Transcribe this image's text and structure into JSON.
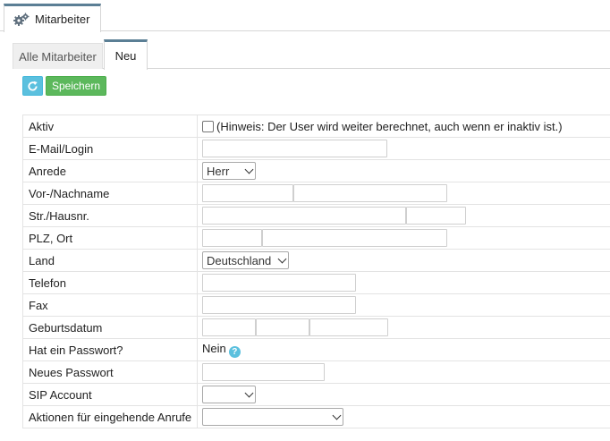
{
  "top_tab": {
    "label": "Mitarbeiter",
    "icon": "gears-icon"
  },
  "sub_tabs": [
    {
      "label": "Alle Mitarbeiter",
      "active": false
    },
    {
      "label": "Neu",
      "active": true
    }
  ],
  "toolbar": {
    "refresh_icon": "refresh-icon",
    "save_label": "Speichern"
  },
  "colors": {
    "accent_tab": "#5b7f95",
    "refresh_btn": "#5bc0de",
    "save_btn": "#5cb85c"
  },
  "form": {
    "aktiv": {
      "label": "Aktiv",
      "checked": false,
      "hint": "(Hinweis: Der User wird weiter berechnet, auch wenn er inaktiv ist.)"
    },
    "email": {
      "label": "E-Mail/Login",
      "value": ""
    },
    "anrede": {
      "label": "Anrede",
      "selected": "Herr"
    },
    "name": {
      "label": "Vor-/Nachname",
      "first": "",
      "last": ""
    },
    "street": {
      "label": "Str./Hausnr.",
      "street": "",
      "number": ""
    },
    "plz": {
      "label": "PLZ, Ort",
      "plz": "",
      "ort": ""
    },
    "land": {
      "label": "Land",
      "selected": "Deutschland"
    },
    "telefon": {
      "label": "Telefon",
      "value": ""
    },
    "fax": {
      "label": "Fax",
      "value": ""
    },
    "geburtsdatum": {
      "label": "Geburtsdatum",
      "day": "",
      "month": "",
      "year": ""
    },
    "passwort": {
      "label": "Hat ein Passwort?",
      "value": "Nein",
      "help_icon": "help-icon"
    },
    "neues_passwort": {
      "label": "Neues Passwort",
      "value": ""
    },
    "sip": {
      "label": "SIP Account",
      "selected": ""
    },
    "aktionen": {
      "label": "Aktionen für eingehende Anrufe",
      "selected": ""
    }
  }
}
